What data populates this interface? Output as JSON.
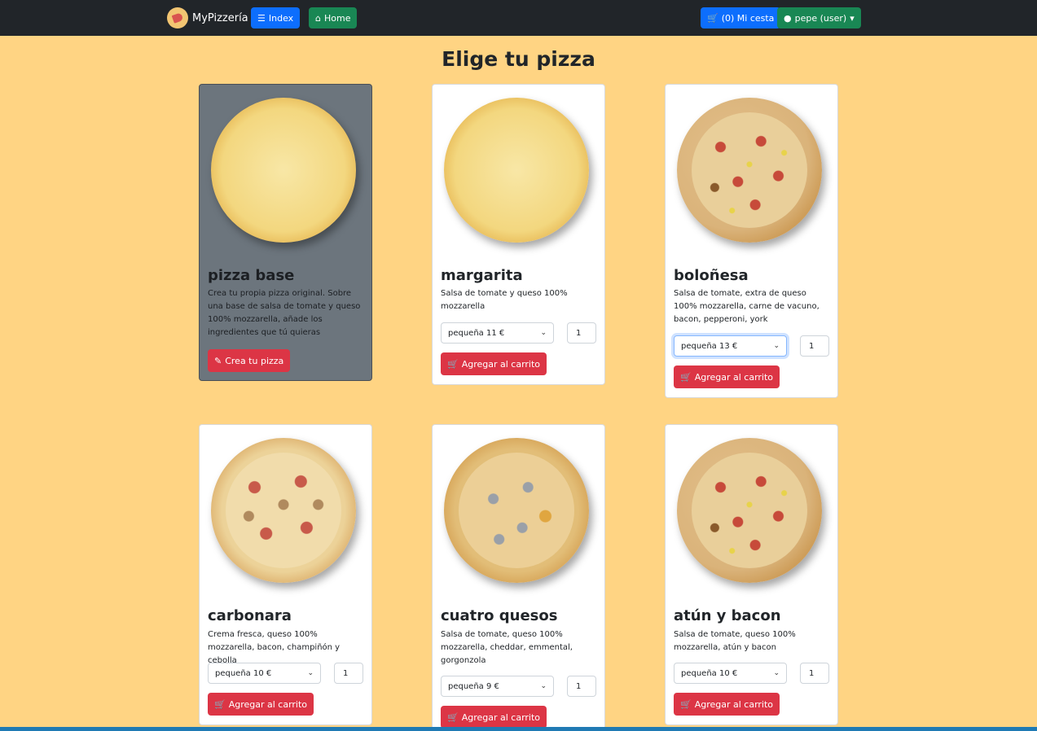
{
  "nav": {
    "brand": "MyPizzería",
    "index": "Index",
    "home": "Home",
    "cart": "(0) Mi cesta",
    "user": "pepe (user)"
  },
  "page_title": "Elige tu pizza",
  "cards": [
    {
      "name": "pizza base",
      "description": "Crea tu propia pizza original. Sobre una base de salsa de tomate y queso 100% mozzarella, añade los ingredientes que tú quieras",
      "button": "Crea tu pizza"
    },
    {
      "name": "margarita",
      "description": "Salsa de tomate y queso 100% mozzarella",
      "size": "pequeña 11 €",
      "qty": "1",
      "button": "Agregar al carrito"
    },
    {
      "name": "boloñesa",
      "description": "Salsa de tomate, extra de queso 100% mozzarella, carne de vacuno, bacon, pepperoni, york",
      "size": "pequeña 13 €",
      "qty": "1",
      "button": "Agregar al carrito"
    },
    {
      "name": "carbonara",
      "description": "Crema fresca, queso 100% mozzarella, bacon, champiñón y cebolla",
      "size": "pequeña 10 €",
      "qty": "1",
      "button": "Agregar al carrito"
    },
    {
      "name": "cuatro quesos",
      "description": "Salsa de tomate, queso 100% mozzarella, cheddar, emmental, gorgonzola",
      "size": "pequeña 9 €",
      "qty": "1",
      "button": "Agregar al carrito"
    },
    {
      "name": "atún y bacon",
      "description": "Salsa de tomate, queso 100% mozzarella, atún y bacon",
      "size": "pequeña 10 €",
      "qty": "1",
      "button": "Agregar al carrito"
    }
  ]
}
